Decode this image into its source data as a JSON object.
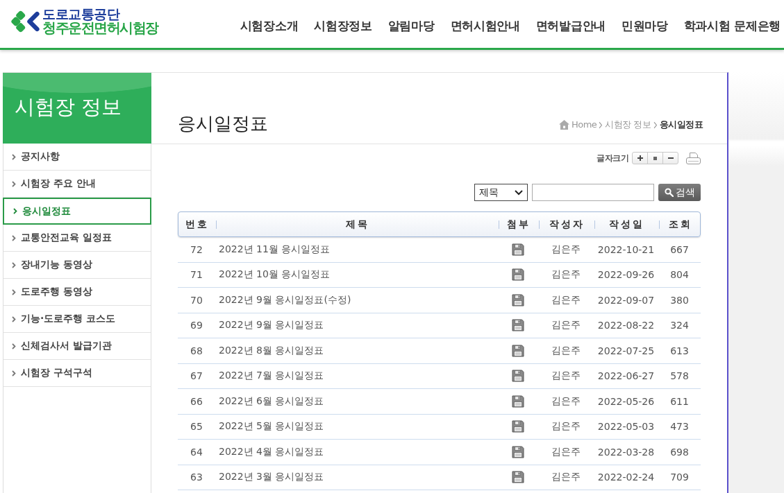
{
  "header": {
    "logo": {
      "organization": "도로교통공단",
      "site_name": "청주운전면허시험장"
    },
    "nav": [
      {
        "label": "시험장소개"
      },
      {
        "label": "시험장정보"
      },
      {
        "label": "알림마당"
      },
      {
        "label": "면허시험안내"
      },
      {
        "label": "면허발급안내"
      },
      {
        "label": "민원마당"
      },
      {
        "label": "학과시험 문제은행"
      }
    ]
  },
  "sidebar": {
    "title": "시험장 정보",
    "items": [
      {
        "label": "공지사항",
        "selected": false
      },
      {
        "label": "시험장 주요 안내",
        "selected": false
      },
      {
        "label": "응시일정표",
        "selected": true
      },
      {
        "label": "교통안전교육 일정표",
        "selected": false
      },
      {
        "label": "장내기능 동영상",
        "selected": false
      },
      {
        "label": "도로주행 동영상",
        "selected": false
      },
      {
        "label": "기능·도로주행 코스도",
        "selected": false
      },
      {
        "label": "신체검사서 발급기관",
        "selected": false
      },
      {
        "label": "시험장 구석구석",
        "selected": false
      }
    ]
  },
  "content": {
    "title": "응시일정표",
    "breadcrumb": [
      {
        "label": "Home",
        "current": false
      },
      {
        "label": "시험장 정보",
        "current": false
      },
      {
        "label": "응시일정표",
        "current": true
      }
    ],
    "font_size_label": "글자크기",
    "search": {
      "category": "제목",
      "button": "검색"
    },
    "table": {
      "columns": [
        "번호",
        "제목",
        "첨부",
        "작성자",
        "작성일",
        "조회"
      ],
      "rows": [
        {
          "number": "72",
          "title": "2022년 11월 응시일정표",
          "attachment": true,
          "author": "김은주",
          "date": "2022-10-21",
          "views": "667"
        },
        {
          "number": "71",
          "title": "2022년 10월 응시일정표",
          "attachment": true,
          "author": "김은주",
          "date": "2022-09-26",
          "views": "804"
        },
        {
          "number": "70",
          "title": "2022년 9월 응시일정표(수정)",
          "attachment": true,
          "author": "김은주",
          "date": "2022-09-07",
          "views": "380"
        },
        {
          "number": "69",
          "title": "2022년 9월 응시일정표",
          "attachment": true,
          "author": "김은주",
          "date": "2022-08-22",
          "views": "324"
        },
        {
          "number": "68",
          "title": "2022년 8월 응시일정표",
          "attachment": true,
          "author": "김은주",
          "date": "2022-07-25",
          "views": "613"
        },
        {
          "number": "67",
          "title": "2022년 7월 응시일정표",
          "attachment": true,
          "author": "김은주",
          "date": "2022-06-27",
          "views": "578"
        },
        {
          "number": "66",
          "title": "2022년 6월 응시일정표",
          "attachment": true,
          "author": "김은주",
          "date": "2022-05-26",
          "views": "611"
        },
        {
          "number": "65",
          "title": "2022년 5월 응시일정표",
          "attachment": true,
          "author": "김은주",
          "date": "2022-05-03",
          "views": "473"
        },
        {
          "number": "64",
          "title": "2022년 4월 응시일정표",
          "attachment": true,
          "author": "김은주",
          "date": "2022-03-28",
          "views": "698"
        },
        {
          "number": "63",
          "title": "2022년 3월 응시일정표",
          "attachment": true,
          "author": "김은주",
          "date": "2022-02-24",
          "views": "709"
        }
      ]
    }
  }
}
